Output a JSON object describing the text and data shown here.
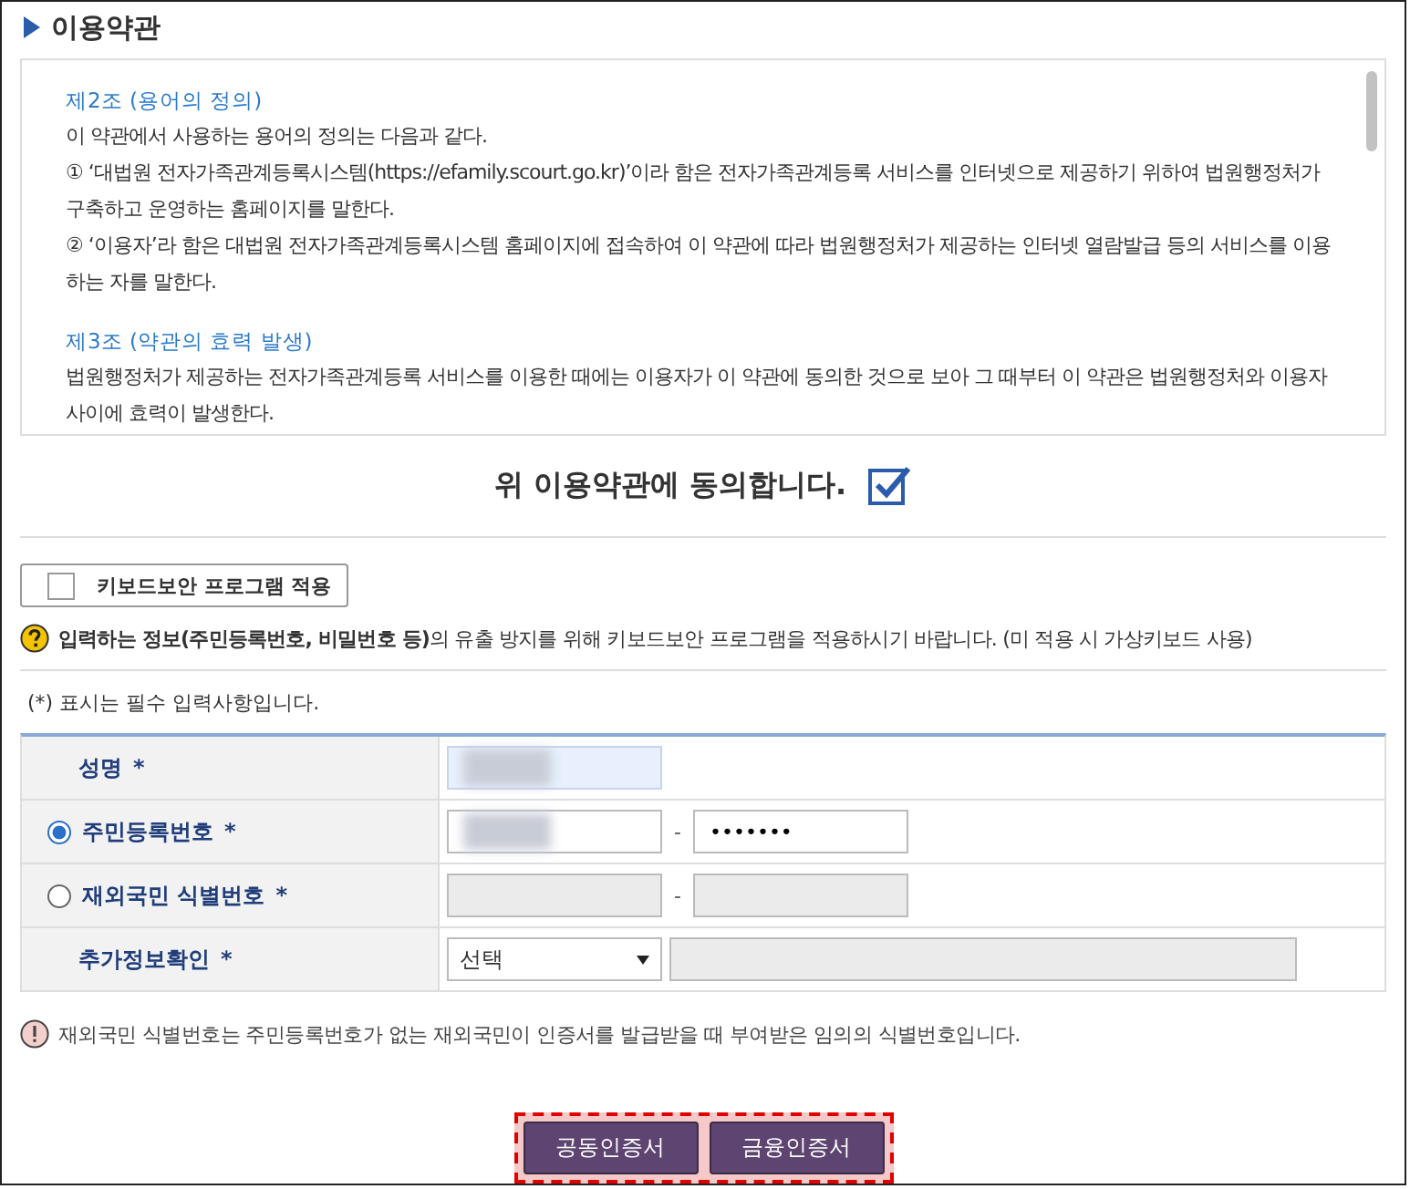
{
  "section_title": "이용약관",
  "terms": [
    {
      "kind": "heading",
      "text": "제2조 (용어의 정의)"
    },
    {
      "kind": "para",
      "text": "이 약관에서 사용하는 용어의 정의는 다음과 같다."
    },
    {
      "kind": "para",
      "text": "① ‘대법원 전자가족관계등록시스템(https://efamily.scourt.go.kr)’이라 함은 전자가족관계등록 서비스를 인터넷으로 제공하기 위하여 법원행정처가 구축하고 운영하는 홈페이지를 말한다."
    },
    {
      "kind": "para",
      "text": "② ‘이용자’라 함은 대법원 전자가족관계등록시스템 홈페이지에 접속하여 이 약관에 따라 법원행정처가 제공하는 인터넷 열람발급 등의 서비스를 이용하는 자를 말한다."
    },
    {
      "kind": "heading",
      "text": "제3조 (약관의 효력 발생)"
    },
    {
      "kind": "para",
      "text": "법원행정처가 제공하는 전자가족관계등록 서비스를 이용한 때에는 이용자가 이 약관에 동의한 것으로 보아 그 때부터 이 약관은 법원행정처와 이용자 사이에 효력이 발생한다."
    }
  ],
  "agree": {
    "label": "위 이용약관에 동의합니다.",
    "checked": true
  },
  "keyboard_security": {
    "label": "키보드보안 프로그램 적용",
    "checked": false
  },
  "info_notice": "**입력하는 정보(주민등록번호, 비밀번호 등)**의 유출 방지를 위해 키보드보안 프로그램을 적용하시기 바랍니다. (미 적용 시 가상키보드 사용)",
  "required_note": "(*) 표시는 필수 입력사항입니다.",
  "form_rows": [
    {
      "kind": "single",
      "label": "성명",
      "mark": "*",
      "fields": [
        {
          "blurred": true,
          "disabled": false,
          "highlight": true
        }
      ]
    },
    {
      "kind": "radio",
      "label": "주민등록번호",
      "mark": "*",
      "selected": true,
      "separator": "-",
      "fields": [
        {
          "blurred": true,
          "disabled": false,
          "highlight": false
        },
        {
          "value": "•••••••",
          "blurred": false,
          "disabled": false,
          "highlight": false
        }
      ]
    },
    {
      "kind": "radio",
      "label": "재외국민 식별번호",
      "mark": "*",
      "selected": false,
      "separator": "-",
      "fields": [
        {
          "blurred": false,
          "disabled": true,
          "highlight": false
        },
        {
          "blurred": false,
          "disabled": true,
          "highlight": false
        }
      ]
    },
    {
      "kind": "select",
      "label": "추가정보확인",
      "mark": "*",
      "select": "선택",
      "fields": [
        {
          "blurred": false,
          "disabled": true,
          "highlight": false
        }
      ]
    }
  ],
  "warning_note": "재외국민 식별번호는 주민등록번호가 없는 재외국민이 인증서를 발급받을 때 부여받은 임의의 식별번호입니다.",
  "buttons": [
    "공동인증서",
    "금융인증서"
  ]
}
